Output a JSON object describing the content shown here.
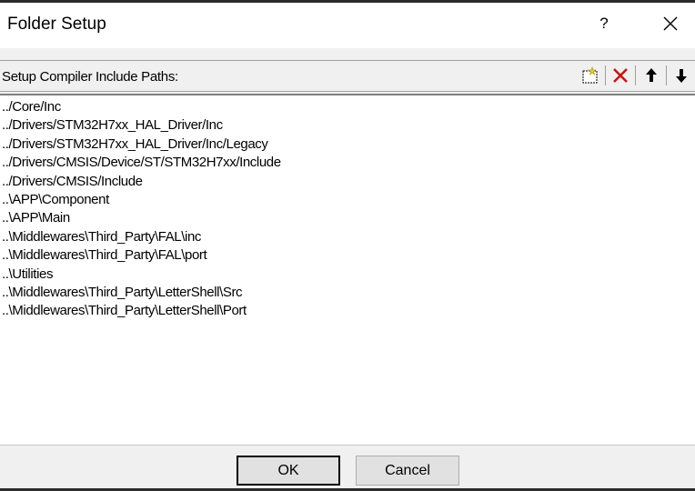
{
  "dialog": {
    "title": "Folder Setup",
    "help_label": "?"
  },
  "toolbar": {
    "label": "Setup Compiler Include Paths:",
    "buttons": [
      {
        "name": "new-folder",
        "icon": "new-folder-icon"
      },
      {
        "name": "delete",
        "icon": "delete-icon",
        "color": "#d01010"
      },
      {
        "name": "move-up",
        "icon": "arrow-up-icon"
      },
      {
        "name": "move-down",
        "icon": "arrow-down-icon"
      }
    ]
  },
  "paths": [
    "../Core/Inc",
    "../Drivers/STM32H7xx_HAL_Driver/Inc",
    "../Drivers/STM32H7xx_HAL_Driver/Inc/Legacy",
    "../Drivers/CMSIS/Device/ST/STM32H7xx/Include",
    "../Drivers/CMSIS/Include",
    "..\\APP\\Component",
    "..\\APP\\Main",
    "..\\Middlewares\\Third_Party\\FAL\\inc",
    "..\\Middlewares\\Third_Party\\FAL\\port",
    "..\\Utilities",
    "..\\Middlewares\\Third_Party\\LetterShell\\Src",
    "..\\Middlewares\\Third_Party\\LetterShell\\Port"
  ],
  "footer": {
    "ok_label": "OK",
    "cancel_label": "Cancel"
  }
}
